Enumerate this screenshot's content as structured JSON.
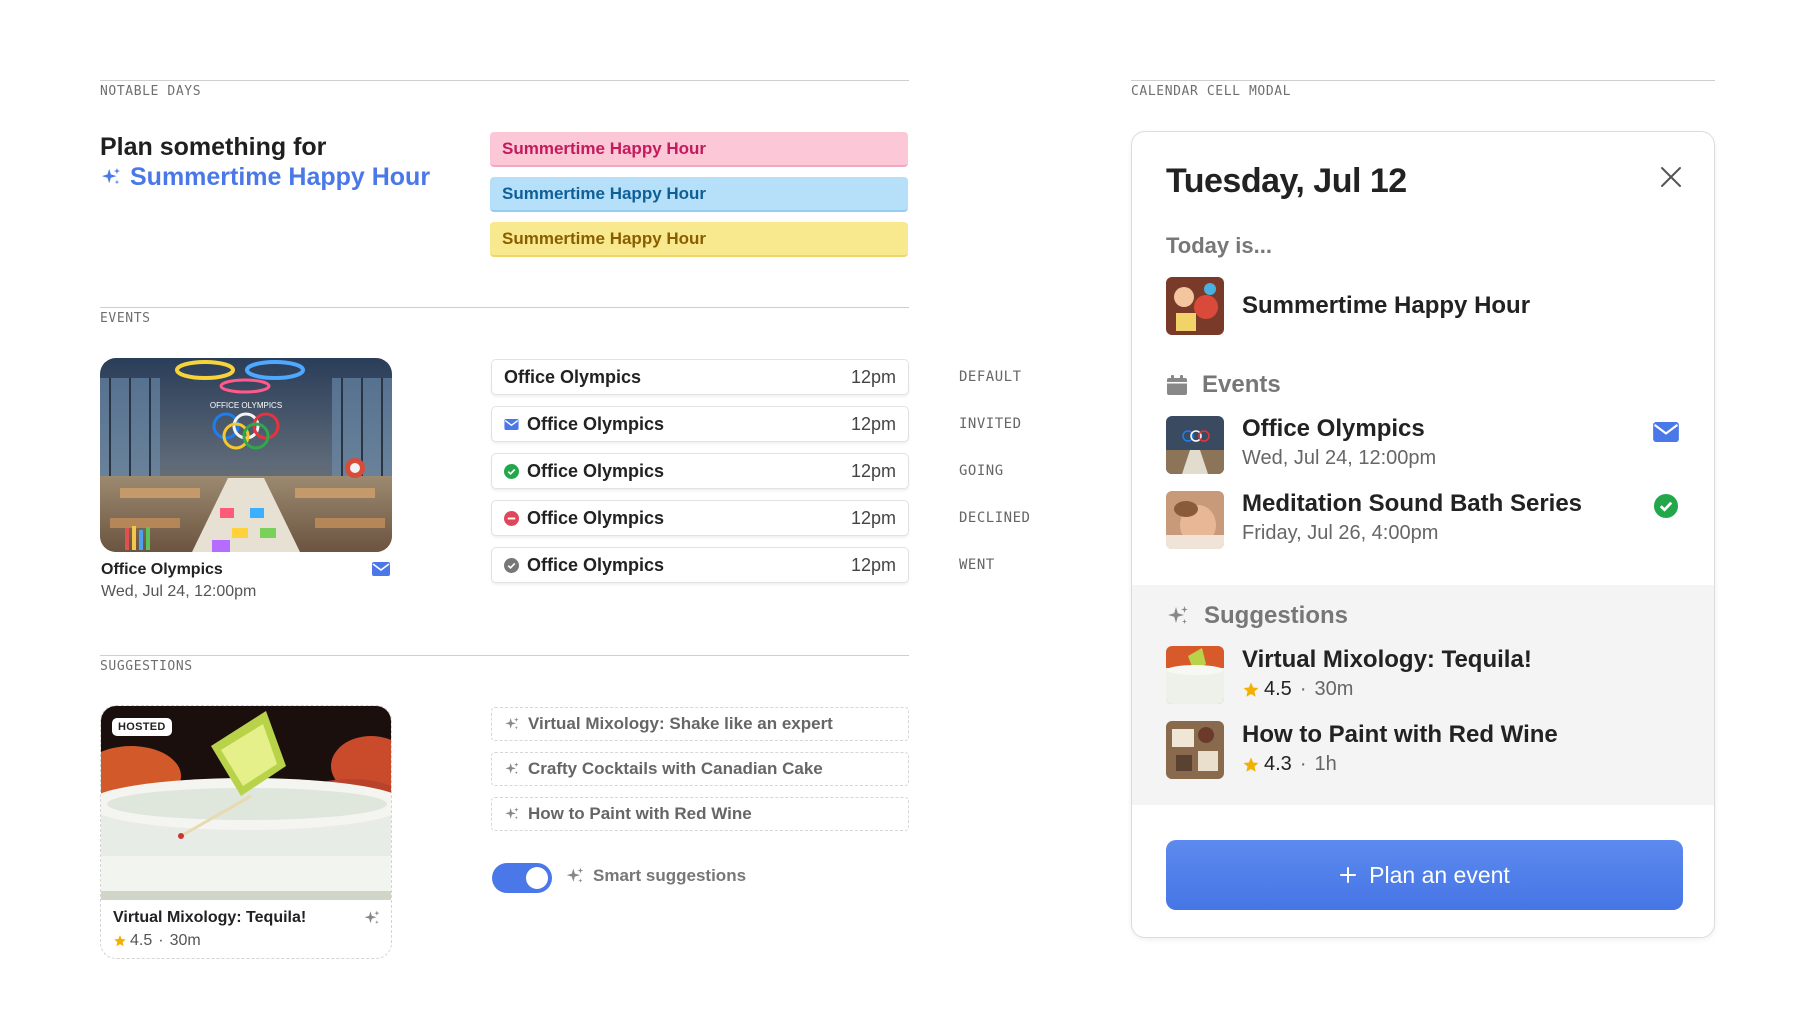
{
  "notable_days": {
    "section_label": "NOTABLE DAYS",
    "plan_title": "Plan something for",
    "plan_subtitle": "Summertime Happy Hour",
    "pills": [
      "Summertime Happy Hour",
      "Summertime Happy Hour",
      "Summertime Happy Hour"
    ]
  },
  "events": {
    "section_label": "EVENTS",
    "card": {
      "title": "Office Olympics",
      "date": "Wed, Jul 24, 12:00pm",
      "image_text": "OFFICE OLYMPICS"
    },
    "rows": [
      {
        "title": "Office Olympics",
        "time": "12pm",
        "state": "DEFAULT"
      },
      {
        "title": "Office Olympics",
        "time": "12pm",
        "state": "INVITED"
      },
      {
        "title": "Office Olympics",
        "time": "12pm",
        "state": "GOING"
      },
      {
        "title": "Office Olympics",
        "time": "12pm",
        "state": "DECLINED"
      },
      {
        "title": "Office Olympics",
        "time": "12pm",
        "state": "WENT"
      }
    ]
  },
  "suggestions": {
    "section_label": "SUGGESTIONS",
    "card": {
      "badge": "HOSTED",
      "title": "Virtual Mixology: Tequila!",
      "rating": "4.5",
      "duration": "30m"
    },
    "rows": [
      "Virtual Mixology: Shake like an expert",
      "Crafty Cocktails with Canadian Cake",
      "How to Paint with Red Wine"
    ],
    "toggle_label": "Smart suggestions",
    "toggle_on": true
  },
  "modal": {
    "section_label": "CALENDAR CELL MODAL",
    "title": "Tuesday, Jul 12",
    "today_label": "Today is...",
    "today_item": "Summertime Happy Hour",
    "events_heading": "Events",
    "events": [
      {
        "title": "Office Olympics",
        "date": "Wed, Jul 24, 12:00pm"
      },
      {
        "title": "Meditation Sound Bath Series",
        "date": "Friday, Jul 26, 4:00pm"
      }
    ],
    "suggestions_heading": "Suggestions",
    "suggestions": [
      {
        "title": "Virtual Mixology: Tequila!",
        "rating": "4.5",
        "duration": "30m"
      },
      {
        "title": "How to Paint with Red Wine",
        "rating": "4.3",
        "duration": "1h"
      }
    ],
    "separator": "·",
    "button_label": "Plan an event"
  },
  "colors": {
    "accent": "#4a78e8",
    "going": "#22a84a",
    "declined": "#e0485a",
    "went": "#777777",
    "star": "#f2b100"
  }
}
